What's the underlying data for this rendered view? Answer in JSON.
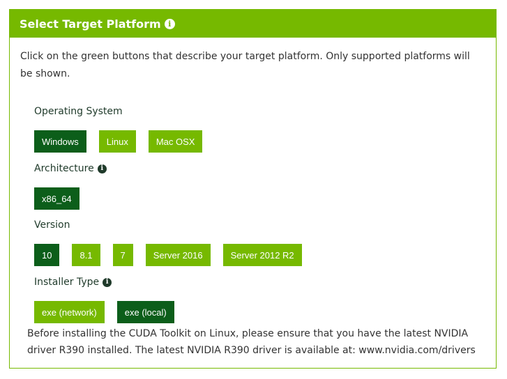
{
  "header": {
    "title": "Select Target Platform",
    "info_icon": "info-icon"
  },
  "intro_text": "Click on the green buttons that describe your target platform. Only supported platforms will be shown.",
  "colors": {
    "accent": "#76b900",
    "selected": "#0c5e1a",
    "label": "#1f3a2a"
  },
  "sections": {
    "os": {
      "label": "Operating System",
      "options": [
        {
          "label": "Windows",
          "selected": true
        },
        {
          "label": "Linux",
          "selected": false
        },
        {
          "label": "Mac OSX",
          "selected": false
        }
      ]
    },
    "arch": {
      "label": "Architecture",
      "options": [
        {
          "label": "x86_64",
          "selected": true
        }
      ]
    },
    "version": {
      "label": "Version",
      "options": [
        {
          "label": "10",
          "selected": true
        },
        {
          "label": "8.1",
          "selected": false
        },
        {
          "label": "7",
          "selected": false
        },
        {
          "label": "Server 2016",
          "selected": false
        },
        {
          "label": "Server 2012 R2",
          "selected": false
        }
      ]
    },
    "installer": {
      "label": "Installer Type",
      "options": [
        {
          "label": "exe (network)",
          "selected": false
        },
        {
          "label": "exe (local)",
          "selected": true
        }
      ]
    }
  },
  "footer_note": "Before installing the CUDA Toolkit on Linux, please ensure that you have the latest NVIDIA driver R390 installed. The latest NVIDIA R390 driver is available at: www.nvidia.com/drivers"
}
